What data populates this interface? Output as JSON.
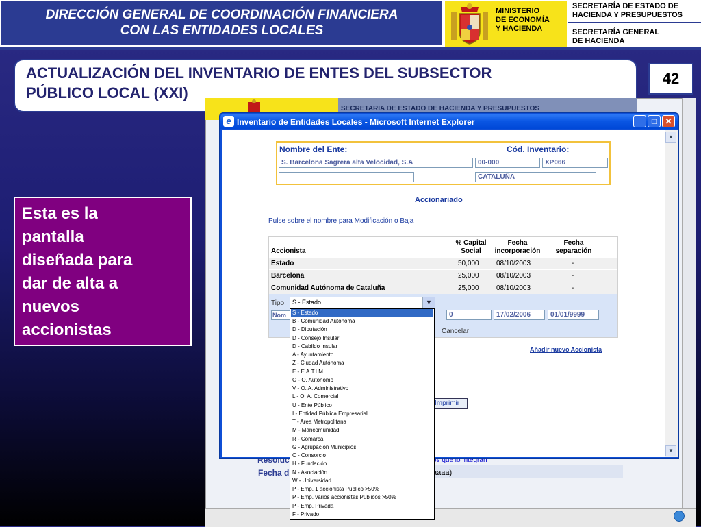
{
  "header": {
    "title_line1": "DIRECCIÓN GENERAL DE COORDINACIÓN FINANCIERA",
    "title_line2": "CON LAS ENTIDADES LOCALES",
    "ministry_line1": "MINISTERIO",
    "ministry_line2": "DE ECONOMÍA",
    "ministry_line3": "Y HACIENDA",
    "sec1_line1": "SECRETARÍA DE ESTADO DE",
    "sec1_line2": "HACIENDA Y PRESUPUESTOS",
    "sec2_line1": "SECRETARÍA GENERAL",
    "sec2_line2": "DE HACIENDA"
  },
  "slide": {
    "title_line1": "ACTUALIZACIÓN DEL INVENTARIO DE ENTES DEL SUBSECTOR",
    "title_line2": "PÚBLICO LOCAL (XXI)",
    "page_number": "42",
    "callout": [
      "Esta es la",
      "pantalla",
      "diseñada para",
      "dar de alta a",
      "nuevos",
      "accionistas"
    ]
  },
  "background_screen": {
    "banner_text": "SECRETARIA DE ESTADO DE HACIENDA Y PRESUPUESTOS",
    "link_text": "os que lo integran",
    "fecha_label": "Fecha d",
    "fecha_hint": "aaaa)"
  },
  "window": {
    "title": "Inventario de Entidades Locales - Microsoft Internet Explorer",
    "icon_letter": "e"
  },
  "form": {
    "nombre_label": "Nombre del Ente:",
    "codigo_label": "Cód. Inventario:",
    "nombre_value": "S. Barcelona Sagrera alta Velocidad, S.A",
    "codigo_value1": "00-000",
    "codigo_value2": "XP066",
    "empty_value": "",
    "region_value": "CATALUÑA",
    "section_title": "Accionariado",
    "instruction": "Pulse sobre el nombre para Modificación o Baja"
  },
  "table": {
    "headers": {
      "accionista": "Accionista",
      "capital_l1": "% Capital",
      "capital_l2": "Social",
      "inc_l1": "Fecha",
      "inc_l2": "incorporación",
      "sep_l1": "Fecha",
      "sep_l2": "separación"
    },
    "rows": [
      {
        "name": "Estado",
        "capital": "50,000",
        "incorporacion": "08/10/2003",
        "separacion": "-"
      },
      {
        "name": "Barcelona",
        "capital": "25,000",
        "incorporacion": "08/10/2003",
        "separacion": "-"
      },
      {
        "name": "Comunidad Autónoma de Cataluña",
        "capital": "25,000",
        "incorporacion": "08/10/2003",
        "separacion": "-"
      }
    ]
  },
  "edit_row": {
    "tipo_label": "Tipo",
    "tipo_selected": "S - Estado",
    "nombre_stub": "Nom",
    "capital": "0",
    "fecha_incorporacion": "17/02/2006",
    "fecha_separacion": "01/01/9999",
    "cancel": "Cancelar",
    "add_link": "Añadir nuevo Accionista",
    "print_button": "Imprimir"
  },
  "dropdown": {
    "options": [
      "S - Estado",
      "B - Comunidad Autónoma",
      "D - Diputación",
      "D - Consejo Insular",
      "D - Cabildo Insular",
      "A - Ayuntamiento",
      "Z - Ciudad Autónoma",
      "E - E.A.T.I.M.",
      "O - O. Autónomo",
      "V - O. A. Administrativo",
      "L - O. A. Comercial",
      "U - Ente Público",
      "I - Entidad Pública Empresarial",
      "T - Area Metropolitana",
      "M - Mancomunidad",
      "R - Comarca",
      "G - Agrupación Municipios",
      "C - Consorcio",
      "H - Fundación",
      "N - Asociación",
      "W - Universidad",
      "P - Emp. 1 accionista Público >50%",
      "P - Emp. varios accionistas Públicos >50%",
      "P - Emp. Privada",
      "F - Privado"
    ]
  },
  "colors": {
    "navy": "#2b3b92",
    "yellow": "#f7e31a",
    "purple": "#800080",
    "xp_blue": "#0a56e3",
    "highlight": "#316ac5"
  }
}
